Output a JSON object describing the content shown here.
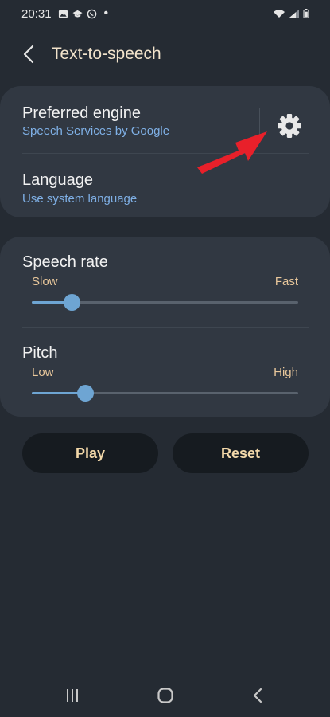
{
  "status_bar": {
    "time": "20:31",
    "left_icons": [
      "gallery-icon",
      "graduation-cap-icon",
      "whatsapp-icon"
    ],
    "dot": "•",
    "right_icons": [
      "wifi-icon",
      "signal-icon",
      "battery-icon"
    ]
  },
  "header": {
    "title": "Text-to-speech",
    "back_icon": "back-arrow-icon"
  },
  "engine_card": {
    "engine_label": "Preferred engine",
    "engine_value": "Speech Services by Google",
    "settings_icon": "gear-icon",
    "language_label": "Language",
    "language_value": "Use system language"
  },
  "annotation": {
    "arrow_color": "#e8202a",
    "points_to": "gear-icon"
  },
  "speech_rate": {
    "label": "Speech rate",
    "min_label": "Slow",
    "max_label": "Fast",
    "value_fraction": 0.15
  },
  "pitch": {
    "label": "Pitch",
    "min_label": "Low",
    "max_label": "High",
    "value_fraction": 0.2
  },
  "buttons": {
    "play_label": "Play",
    "reset_label": "Reset"
  },
  "nav_bar": {
    "icons": [
      "recents-icon",
      "home-icon",
      "back-icon"
    ]
  },
  "colors": {
    "background": "#252b33",
    "card": "#313842",
    "accent": "#6ea5d3",
    "subtitle_blue": "#7fb0e6",
    "label_tan": "#e8c79b",
    "button_text": "#f2d8a9"
  }
}
